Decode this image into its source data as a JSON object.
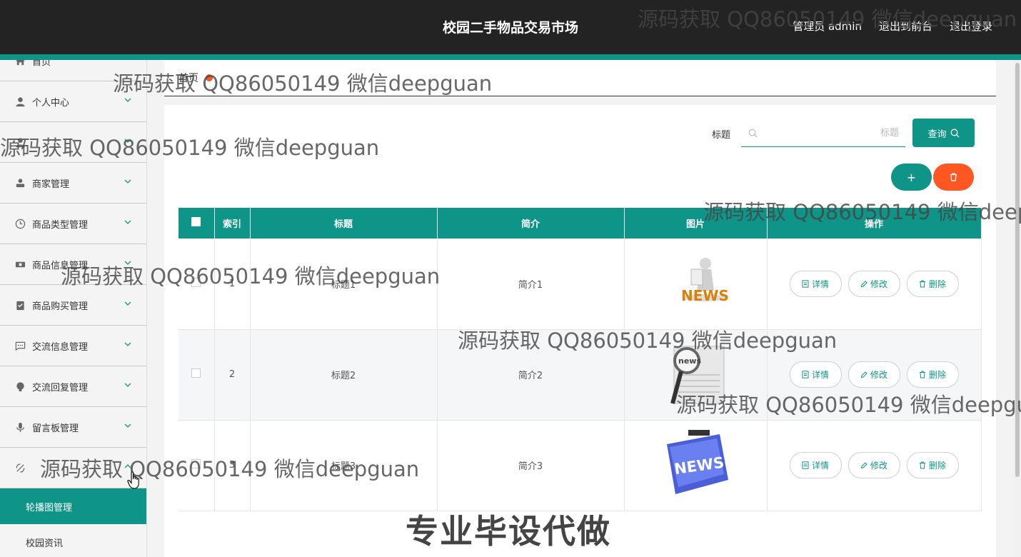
{
  "header": {
    "title": "校园二手物品交易市场",
    "user_label": "管理员 admin",
    "to_front_label": "退出到前台",
    "logout_label": "退出登录"
  },
  "sidebar": {
    "items": [
      {
        "label": "首页",
        "icon": "home-icon"
      },
      {
        "label": "个人中心",
        "icon": "person-icon"
      },
      {
        "label": "商家管理",
        "icon": "merchant-icon"
      },
      {
        "label": "商品类型管理",
        "icon": "clock-icon"
      },
      {
        "label": "商品信息管理",
        "icon": "ticket-icon"
      },
      {
        "label": "商品购买管理",
        "icon": "clipboard-icon"
      },
      {
        "label": "交流信息管理",
        "icon": "chat-icon"
      },
      {
        "label": "交流回复管理",
        "icon": "bulb-icon"
      },
      {
        "label": "留言板管理",
        "icon": "mic-icon"
      }
    ],
    "submenu": [
      {
        "label": "轮播图管理",
        "active": true
      },
      {
        "label": "校园资讯",
        "active": false
      }
    ]
  },
  "breadcrumb": {
    "home": "首页"
  },
  "search": {
    "label": "标题",
    "placeholder": "标题",
    "button_label": "查询"
  },
  "actions": {
    "add_symbol": "+"
  },
  "table": {
    "columns": [
      "索引",
      "标题",
      "简介",
      "图片",
      "操作"
    ],
    "rows": [
      {
        "index": "1",
        "title": "标题1",
        "intro": "简介1",
        "image": "news-figure-image"
      },
      {
        "index": "2",
        "title": "标题2",
        "intro": "简介2",
        "image": "newspaper-magnifier-image"
      },
      {
        "index": "3",
        "title": "标题3",
        "intro": "简介3",
        "image": "news-key-image"
      }
    ],
    "ops": {
      "detail": "详情",
      "edit": "修改",
      "delete": "删除"
    }
  },
  "overlays": {
    "watermark": "源码获取 QQ86050149 微信deepguan",
    "banner": "专业毕设代做"
  },
  "colors": {
    "topbar": "#232323",
    "accent": "#0f9488",
    "danger": "#fe5722"
  }
}
